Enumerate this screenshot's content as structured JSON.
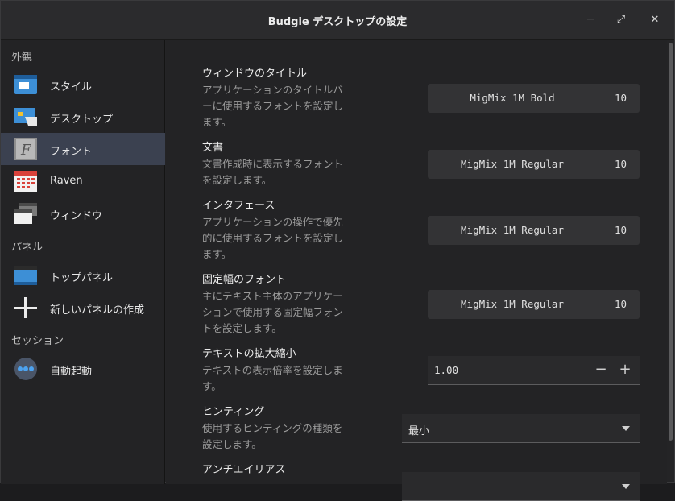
{
  "window": {
    "title": "Budgie デスクトップの設定",
    "minimize": "─",
    "maximize": "⤢",
    "close": "✕"
  },
  "sidebar": {
    "sections": {
      "appearance": "外観",
      "panel": "パネル",
      "session": "セッション"
    },
    "items": [
      {
        "label": "スタイル",
        "icon": "style-icon"
      },
      {
        "label": "デスクトップ",
        "icon": "desktop-icon"
      },
      {
        "label": "フォント",
        "icon": "font-icon",
        "active": true
      },
      {
        "label": "Raven",
        "icon": "calendar-icon"
      },
      {
        "label": "ウィンドウ",
        "icon": "window-icon"
      },
      {
        "label": "トップパネル",
        "icon": "top-panel-icon"
      },
      {
        "label": "新しいパネルの作成",
        "icon": "plus-icon"
      },
      {
        "label": "自動起動",
        "icon": "autostart-icon"
      }
    ]
  },
  "settings": {
    "window_title": {
      "title": "ウィンドウのタイトル",
      "desc": "アプリケーションのタイトルバーに使用するフォントを設定します。",
      "font": "MigMix 1M Bold",
      "size": "10"
    },
    "document": {
      "title": "文書",
      "desc": "文書作成時に表示するフォントを設定します。",
      "font": "MigMix 1M Regular",
      "size": "10"
    },
    "interface": {
      "title": "インタフェース",
      "desc": "アプリケーションの操作で優先的に使用するフォントを設定します。",
      "font": "MigMix 1M Regular",
      "size": "10"
    },
    "monospace": {
      "title": "固定幅のフォント",
      "desc": "主にテキスト主体のアプリケーションで使用する固定幅フォントを設定します。",
      "font": "MigMix 1M Regular",
      "size": "10"
    },
    "text_scale": {
      "title": "テキストの拡大縮小",
      "desc": "テキストの表示倍率を設定します。",
      "value": "1.00",
      "minus": "−",
      "plus": "+"
    },
    "hinting": {
      "title": "ヒンティング",
      "desc": "使用するヒンティングの種類を設定します。",
      "value": "最小"
    },
    "antialiasing": {
      "title": "アンチエイリアス"
    }
  },
  "colors": {
    "accent_blue": "#3d8fd6",
    "active_row": "#3b4150"
  }
}
